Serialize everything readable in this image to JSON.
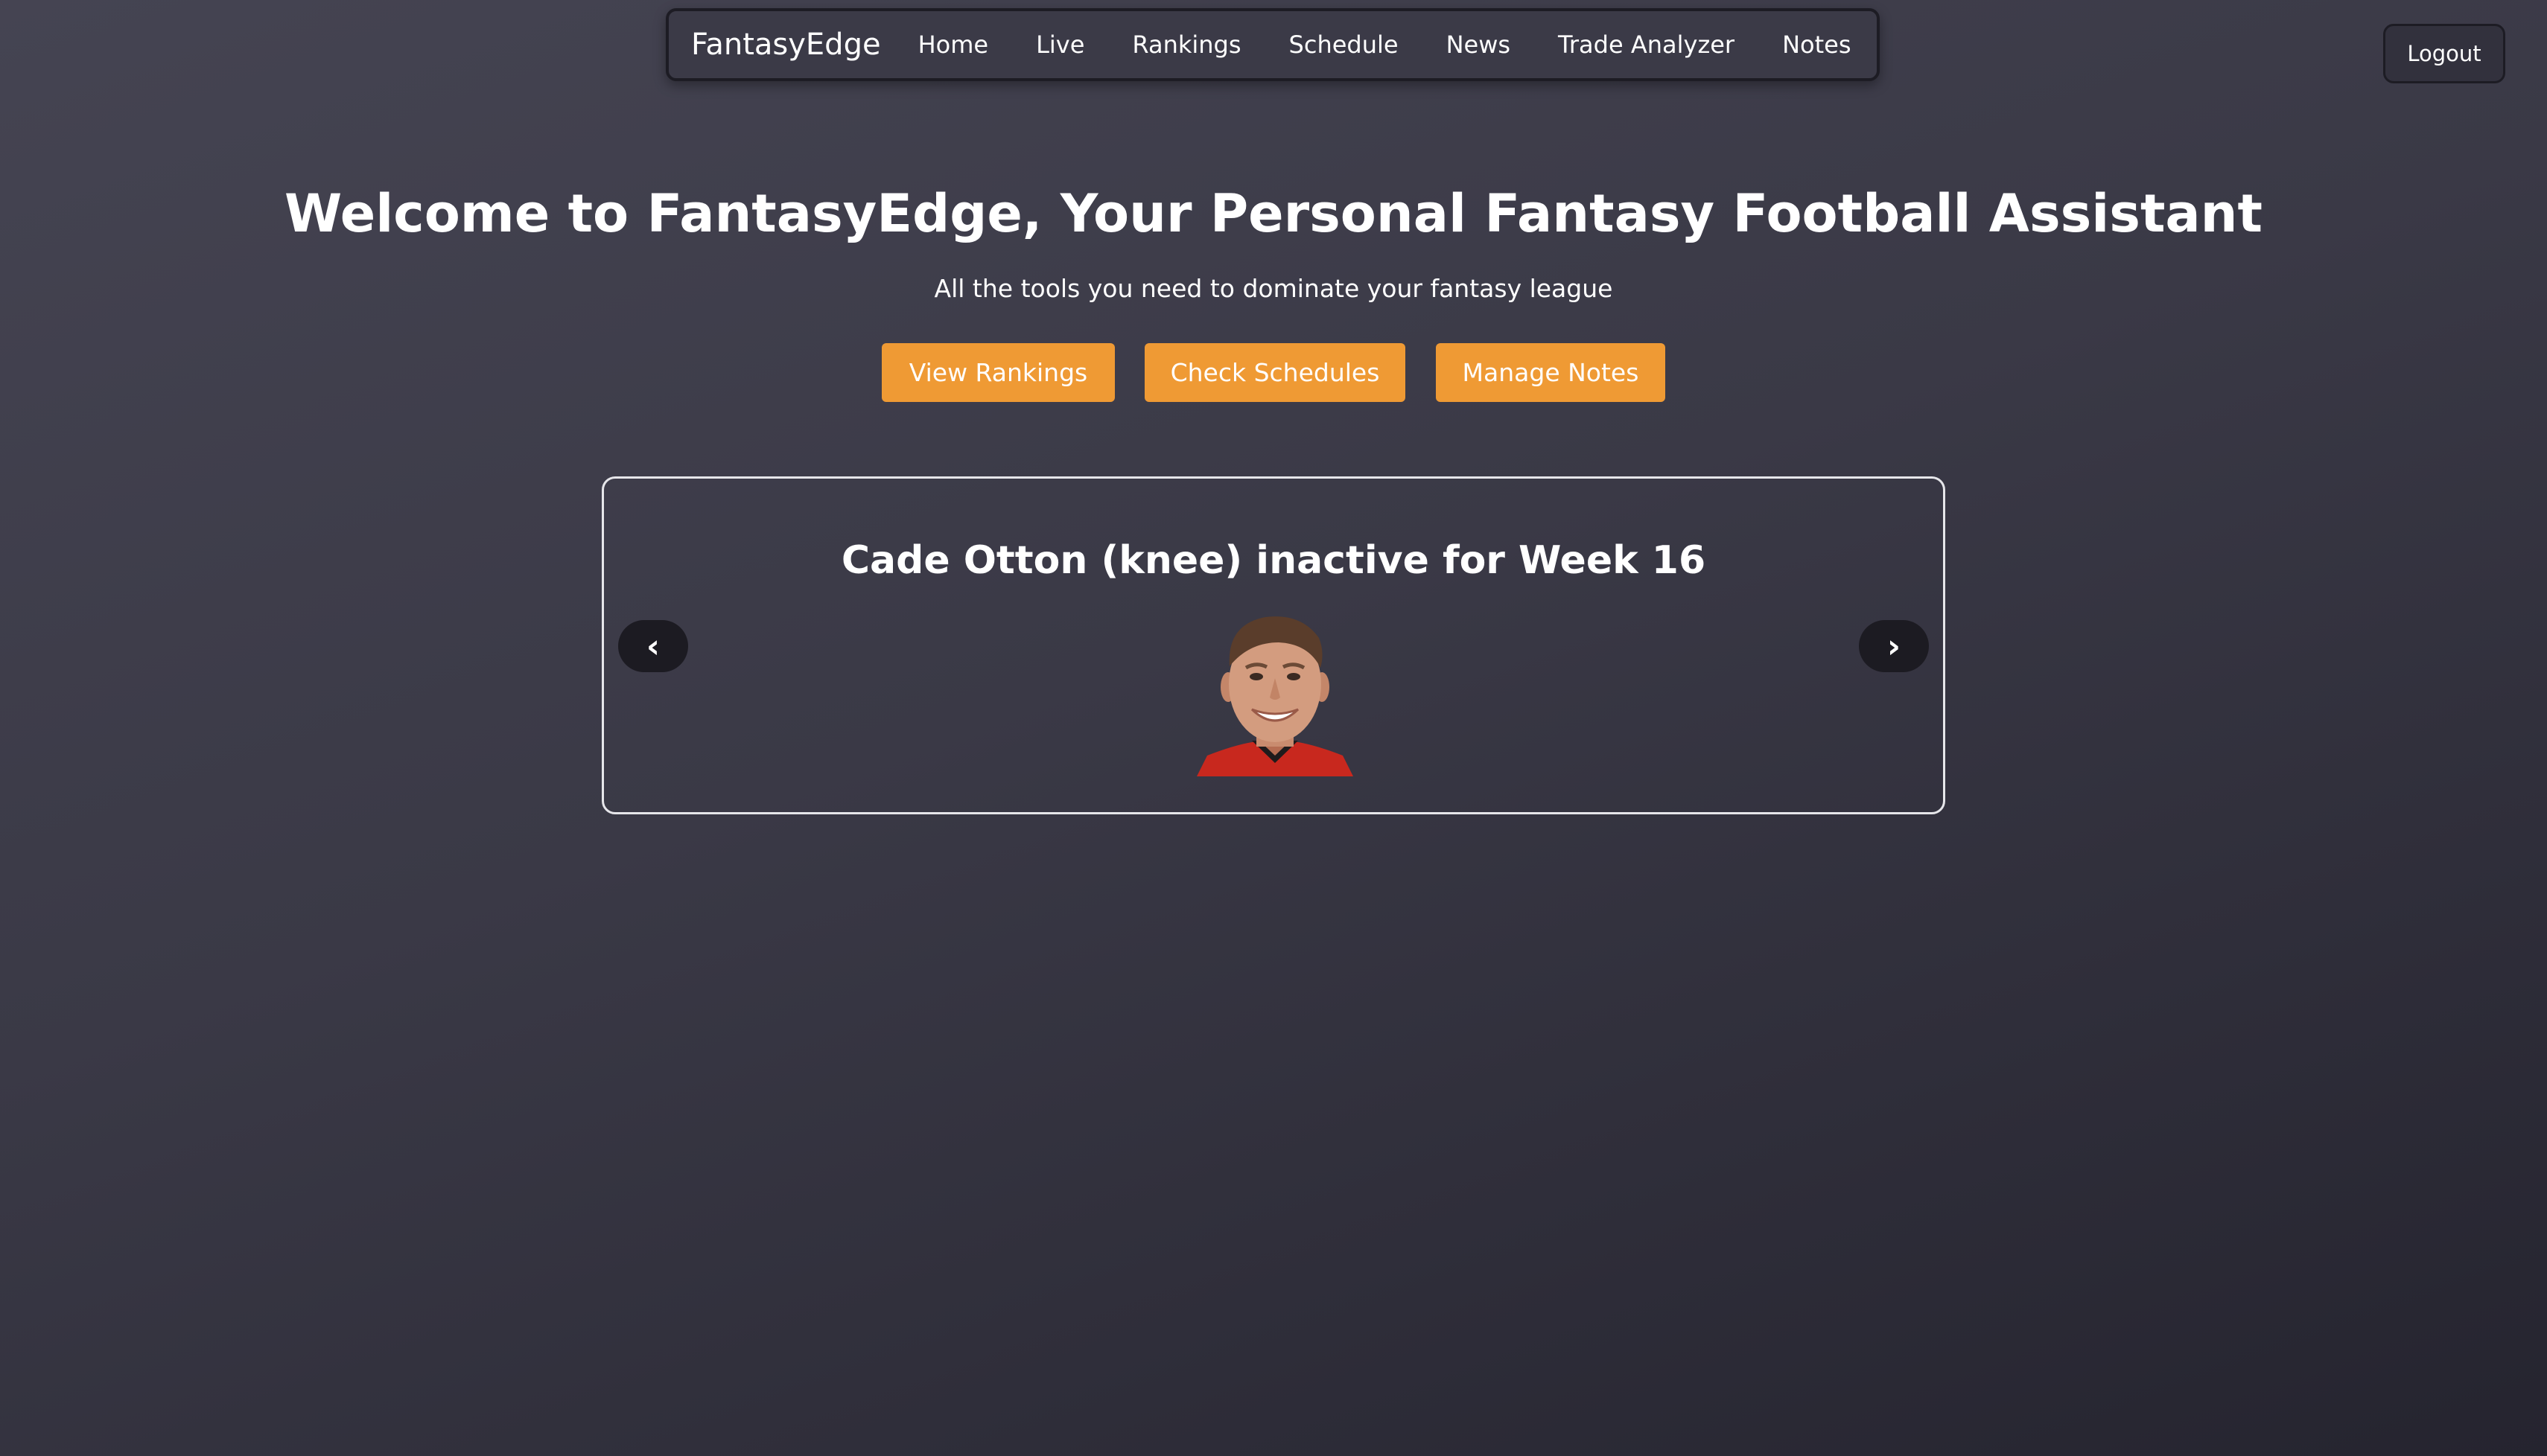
{
  "nav": {
    "brand": "FantasyEdge",
    "links": [
      "Home",
      "Live",
      "Rankings",
      "Schedule",
      "News",
      "Trade Analyzer",
      "Notes"
    ]
  },
  "logout_label": "Logout",
  "hero": {
    "title": "Welcome to FantasyEdge, Your Personal Fantasy Football Assistant",
    "subtitle": "All the tools you need to dominate your fantasy league",
    "buttons": [
      "View Rankings",
      "Check Schedules",
      "Manage Notes"
    ]
  },
  "news_carousel": {
    "headline": "Cade Otton (knee) inactive for Week 16",
    "prev_icon": "chevron-left-icon",
    "next_icon": "chevron-right-icon",
    "prev_glyph": "‹",
    "next_glyph": "›",
    "image": "player-headshot"
  },
  "colors": {
    "accent": "#ef9a34",
    "background_top": "#454452",
    "background_bottom": "#25242f",
    "jersey": "#c8281e"
  }
}
